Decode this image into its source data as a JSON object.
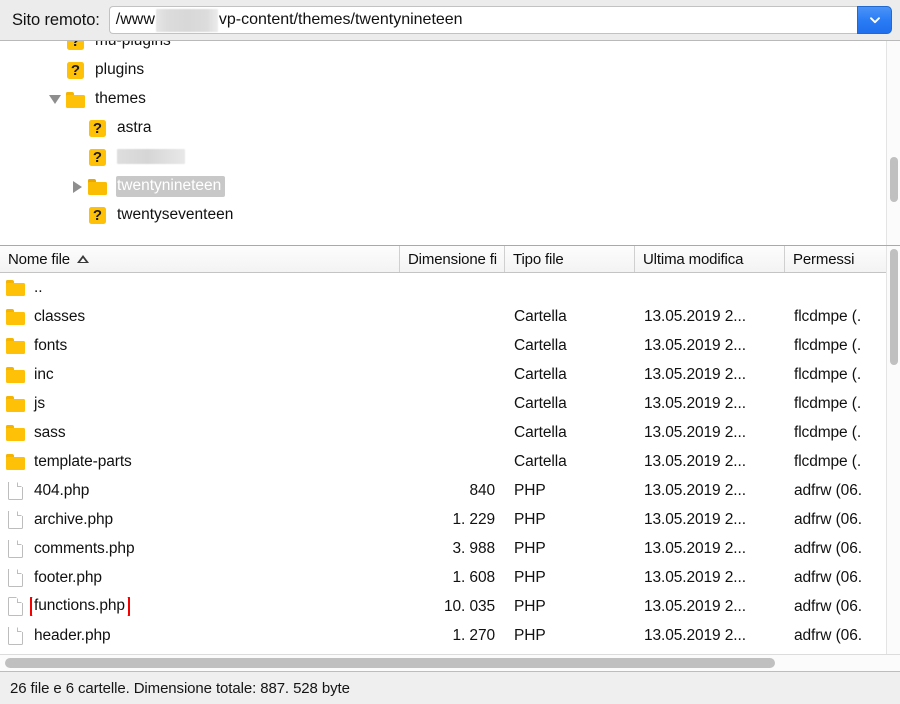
{
  "topbar": {
    "label": "Sito remoto:",
    "path_prefix": "/www",
    "path_suffix": "vp-content/themes/twentynineteen",
    "path_full_visible": "/www[redacted]vp-content/themes/twentynineteen",
    "dropdown_icon": "chevron-down-icon",
    "accent_color": "#2b7cf5"
  },
  "tree": {
    "items": [
      {
        "label": "mu-plugins",
        "icon": "question-folder-icon",
        "indent": 2,
        "twisty": "none",
        "selected": false,
        "redacted": false
      },
      {
        "label": "plugins",
        "icon": "question-folder-icon",
        "indent": 2,
        "twisty": "none",
        "selected": false,
        "redacted": false
      },
      {
        "label": "themes",
        "icon": "folder-icon",
        "indent": 2,
        "twisty": "open",
        "selected": false,
        "redacted": false
      },
      {
        "label": "astra",
        "icon": "question-folder-icon",
        "indent": 3,
        "twisty": "none",
        "selected": false,
        "redacted": false
      },
      {
        "label": "",
        "icon": "question-folder-icon",
        "indent": 3,
        "twisty": "none",
        "selected": false,
        "redacted": true
      },
      {
        "label": "twentynineteen",
        "icon": "folder-open-icon",
        "indent": 3,
        "twisty": "closed",
        "selected": true,
        "redacted": false
      },
      {
        "label": "twentyseventeen",
        "icon": "question-folder-icon",
        "indent": 3,
        "twisty": "none",
        "selected": false,
        "redacted": false
      }
    ]
  },
  "filelist": {
    "columns": [
      {
        "key": "name",
        "label": "Nome file",
        "sorted": "asc"
      },
      {
        "key": "size",
        "label": "Dimensione fi"
      },
      {
        "key": "type",
        "label": "Tipo file"
      },
      {
        "key": "mod",
        "label": "Ultima modifica"
      },
      {
        "key": "perm",
        "label": "Permessi"
      }
    ],
    "rows": [
      {
        "name": "..",
        "icon": "folder-icon",
        "size": "",
        "type": "",
        "mod": "",
        "perm": "",
        "highlight": false
      },
      {
        "name": "classes",
        "icon": "folder-icon",
        "size": "",
        "type": "Cartella",
        "mod": "13.05.2019 2...",
        "perm": "flcdmpe (.",
        "highlight": false
      },
      {
        "name": "fonts",
        "icon": "folder-icon",
        "size": "",
        "type": "Cartella",
        "mod": "13.05.2019 2...",
        "perm": "flcdmpe (.",
        "highlight": false
      },
      {
        "name": "inc",
        "icon": "folder-icon",
        "size": "",
        "type": "Cartella",
        "mod": "13.05.2019 2...",
        "perm": "flcdmpe (.",
        "highlight": false
      },
      {
        "name": "js",
        "icon": "folder-icon",
        "size": "",
        "type": "Cartella",
        "mod": "13.05.2019 2...",
        "perm": "flcdmpe (.",
        "highlight": false
      },
      {
        "name": "sass",
        "icon": "folder-icon",
        "size": "",
        "type": "Cartella",
        "mod": "13.05.2019 2...",
        "perm": "flcdmpe (.",
        "highlight": false
      },
      {
        "name": "template-parts",
        "icon": "folder-icon",
        "size": "",
        "type": "Cartella",
        "mod": "13.05.2019 2...",
        "perm": "flcdmpe (.",
        "highlight": false
      },
      {
        "name": "404.php",
        "icon": "file-icon",
        "size": "840",
        "type": "PHP",
        "mod": "13.05.2019 2...",
        "perm": "adfrw (06.",
        "highlight": false
      },
      {
        "name": "archive.php",
        "icon": "file-icon",
        "size": "1. 229",
        "type": "PHP",
        "mod": "13.05.2019 2...",
        "perm": "adfrw (06.",
        "highlight": false
      },
      {
        "name": "comments.php",
        "icon": "file-icon",
        "size": "3. 988",
        "type": "PHP",
        "mod": "13.05.2019 2...",
        "perm": "adfrw (06.",
        "highlight": false
      },
      {
        "name": "footer.php",
        "icon": "file-icon",
        "size": "1. 608",
        "type": "PHP",
        "mod": "13.05.2019 2...",
        "perm": "adfrw (06.",
        "highlight": false
      },
      {
        "name": "functions.php",
        "icon": "file-icon",
        "size": "10. 035",
        "type": "PHP",
        "mod": "13.05.2019 2...",
        "perm": "adfrw (06.",
        "highlight": true
      },
      {
        "name": "header.php",
        "icon": "file-icon",
        "size": "1. 270",
        "type": "PHP",
        "mod": "13.05.2019 2...",
        "perm": "adfrw (06.",
        "highlight": false
      }
    ],
    "highlight_color": "#f50000"
  },
  "statusbar": {
    "text": "26 file e 6 cartelle. Dimensione totale: 887. 528 byte"
  }
}
